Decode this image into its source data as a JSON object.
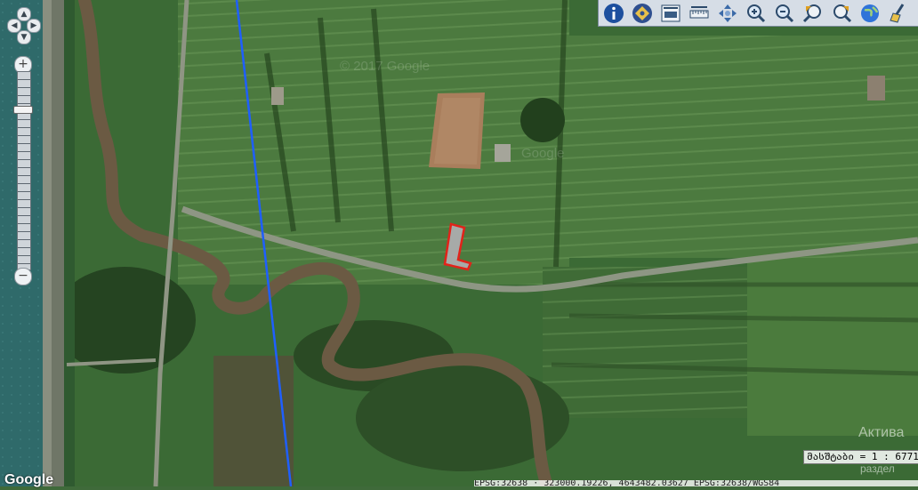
{
  "map": {
    "attribution": "Google",
    "watermark": "© 2017 Google",
    "scale_text": "მასშტაბი = 1 : 6771",
    "coords_text": "EPSG:32638  ·  323000.19226, 4643482.03627  EPSG:32638/WGS84",
    "activate_line1": "Актива",
    "activate_line2": "раздел"
  },
  "toolbar": {
    "tools": [
      {
        "name": "info-tool",
        "icon": "info-icon"
      },
      {
        "name": "layers-tool",
        "icon": "layers-icon"
      },
      {
        "name": "measure-area-tool",
        "icon": "ruler-area-icon"
      },
      {
        "name": "measure-length-tool",
        "icon": "ruler-icon"
      },
      {
        "name": "pan-tool",
        "icon": "move-icon"
      },
      {
        "name": "zoom-in-tool",
        "icon": "zoom-in-icon"
      },
      {
        "name": "zoom-out-tool",
        "icon": "zoom-out-icon"
      },
      {
        "name": "previous-extent-tool",
        "icon": "back-icon"
      },
      {
        "name": "next-extent-tool",
        "icon": "forward-icon"
      },
      {
        "name": "full-extent-tool",
        "icon": "globe-icon"
      },
      {
        "name": "clear-tool",
        "icon": "broom-icon"
      }
    ]
  },
  "zoom": {
    "plus": "+",
    "minus": "−"
  },
  "colors": {
    "parcel_fill": "#a7aaa8",
    "parcel_stroke": "#e2231a",
    "boundary_line": "#1f5fff",
    "river": "#6b5a43"
  }
}
